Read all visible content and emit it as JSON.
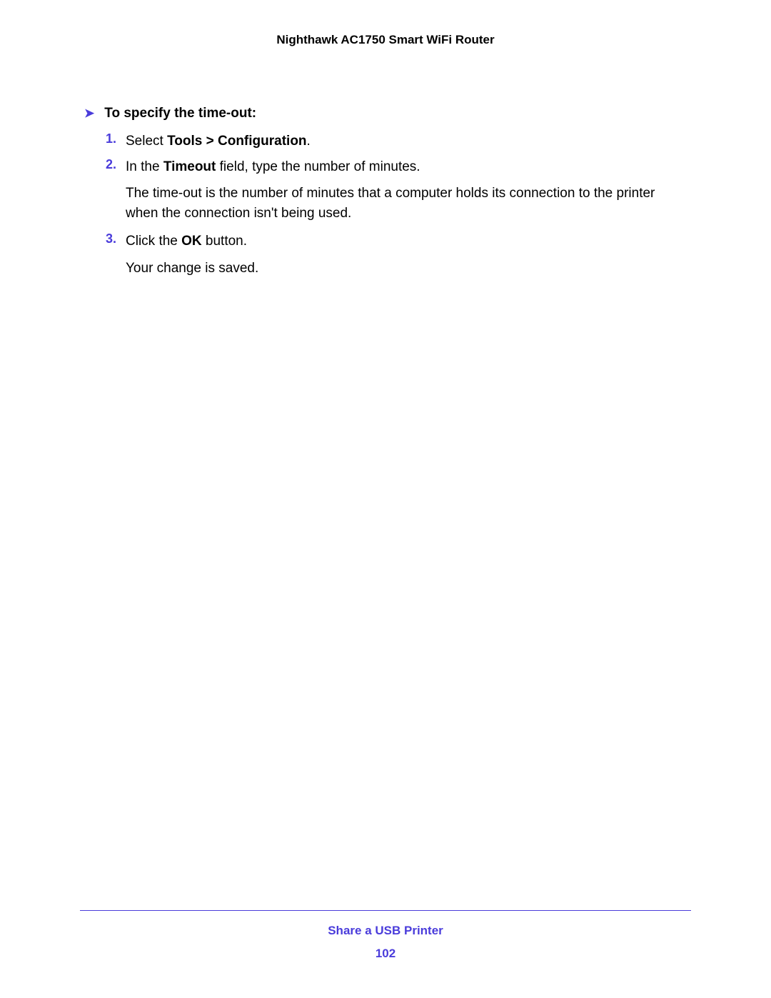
{
  "header": {
    "title": "Nighthawk AC1750 Smart WiFi Router"
  },
  "section": {
    "arrow": "➤",
    "heading": "To specify the time-out:"
  },
  "steps": [
    {
      "number": "1.",
      "prefix": "Select ",
      "bold": "Tools > Configuration",
      "suffix": "."
    },
    {
      "number": "2.",
      "prefix": "In the ",
      "bold": "Timeout",
      "suffix": " field, type the number of minutes.",
      "description": "The time-out is the number of minutes that a computer holds its connection to the printer when the connection isn't being used."
    },
    {
      "number": "3.",
      "prefix": "Click the ",
      "bold": "OK",
      "suffix": " button.",
      "description": "Your change is saved."
    }
  ],
  "footer": {
    "section": "Share a USB Printer",
    "page": "102"
  }
}
